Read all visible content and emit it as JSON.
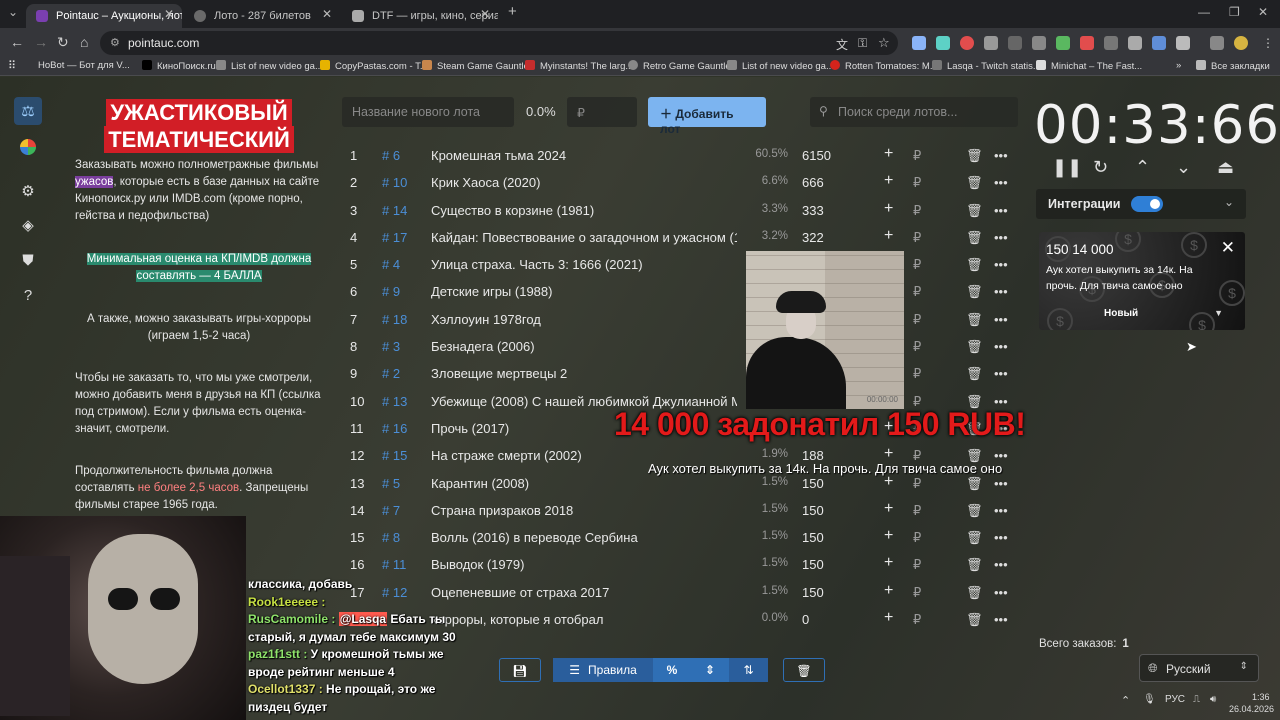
{
  "browser": {
    "tabs": [
      {
        "title": "Pointauc – Аукционы, лотереи",
        "active": true
      },
      {
        "title": "Лото - 287 билетов",
        "active": false
      },
      {
        "title": "DTF — игры, кино, сериалы, р",
        "active": false
      }
    ],
    "url": "pointauc.com",
    "bookmarks": [
      "HoBot — Бот для V...",
      "КиноПоиск.ru",
      "List of new video ga...",
      "CopyPastas.com - T...",
      "Steam Game Gauntlet",
      "Myinstants! The larg...",
      "Retro Game Gauntlet",
      "List of new video ga...",
      "Rotten Tomatoes: M...",
      "Lasqa - Twitch statis...",
      "Minichat – The Fast..."
    ],
    "all_bookmarks": "Все закладки"
  },
  "rules": {
    "title_line1": "УЖАСТИКОВЫЙ",
    "title_line2": "ТЕМАТИЧЕСКИЙ",
    "p1_a": "Заказывать можно полнометражные фильмы ",
    "p1_hl": "ужасов",
    "p1_b": ", которые есть в базе данных на сайте Кинопоиск.ру или IMDB.com (кроме порно, гейства и педофильства)",
    "p2": "Минимальная оценка на КП/IMDB должна составлять — 4 БАЛЛА",
    "p3": "А также, можно заказывать игры-хорроры (играем 1,5-2 часа)",
    "p4": "Чтобы не заказать то, что мы уже смотрели, можно добавить меня в друзья на КП (ссылка под стримом). Если у фильма есть оценка- значит, смотрели.",
    "p5_a": "Продолжительность фильма должна составлять ",
    "p5_red": "не более 2,5 часов",
    "p5_b": ". Запрещены фильмы старее 1965 года."
  },
  "toolbar": {
    "lot_placeholder": "Название нового лота",
    "percent": "0.0%",
    "currency_placeholder": "₽",
    "add_button": "Добавить лот",
    "search_placeholder": "Поиск среди лотов..."
  },
  "lots": [
    {
      "n": "1",
      "id": "# 6",
      "name": "Кромешная тьма 2024",
      "pct": "60.5%",
      "amount": "6150"
    },
    {
      "n": "2",
      "id": "# 10",
      "name": "Крик Хаоса (2020)",
      "pct": "6.6%",
      "amount": "666"
    },
    {
      "n": "3",
      "id": "# 14",
      "name": "Существо в корзине (1981)",
      "pct": "3.3%",
      "amount": "333"
    },
    {
      "n": "4",
      "id": "# 17",
      "name": "Кайдан: Повествование о загадочном и ужасном (19",
      "pct": "3.2%",
      "amount": "322"
    },
    {
      "n": "5",
      "id": "# 4",
      "name": "Улица страха. Часть 3: 1666 (2021)",
      "pct": "",
      "amount": ""
    },
    {
      "n": "6",
      "id": "# 9",
      "name": "Детские игры (1988)",
      "pct": "",
      "amount": ""
    },
    {
      "n": "7",
      "id": "# 18",
      "name": "Хэллоуин 1978год",
      "pct": "",
      "amount": ""
    },
    {
      "n": "8",
      "id": "# 3",
      "name": "Безнадега (2006)",
      "pct": "",
      "amount": ""
    },
    {
      "n": "9",
      "id": "# 2",
      "name": "Зловещие мертвецы 2",
      "pct": "",
      "amount": ""
    },
    {
      "n": "10",
      "id": "# 13",
      "name": "Убежище (2008) С нашей любимкой Джулианной М",
      "pct": "",
      "amount": ""
    },
    {
      "n": "11",
      "id": "# 16",
      "name": "Прочь (2017)",
      "pct": "",
      "amount": ""
    },
    {
      "n": "12",
      "id": "# 15",
      "name": "На страже смерти (2002)",
      "pct": "1.9%",
      "amount": "188"
    },
    {
      "n": "13",
      "id": "# 5",
      "name": "Карантин (2008)",
      "pct": "1.5%",
      "amount": "150"
    },
    {
      "n": "14",
      "id": "# 7",
      "name": "Страна призраков 2018",
      "pct": "1.5%",
      "amount": "150"
    },
    {
      "n": "15",
      "id": "# 8",
      "name": "Волль (2016) в переводе Сербина",
      "pct": "1.5%",
      "amount": "150"
    },
    {
      "n": "16",
      "id": "# 11",
      "name": "Выводок (1979)",
      "pct": "1.5%",
      "amount": "150"
    },
    {
      "n": "17",
      "id": "# 12",
      "name": "Оцепеневшие от страха 2017",
      "pct": "1.5%",
      "amount": "150"
    },
    {
      "n": "",
      "id": "",
      "name": "хорроры, которые я отобрал",
      "pct": "0.0%",
      "amount": "0"
    }
  ],
  "bottom": {
    "rules_label": "Правила"
  },
  "timer": {
    "value": "00:33:66"
  },
  "integrations": {
    "label": "Интеграции",
    "enabled": true
  },
  "donation": {
    "amount": "150 14 000",
    "message": "Аук хотел выкупить за 14к. На прочь. Для твича самое оно",
    "status": "Новый"
  },
  "total": {
    "label": "Всего заказов:",
    "value": "1"
  },
  "language": "Русский",
  "overlay": {
    "alert": "14 000 задонатил 150 RUB!",
    "alert_message": "Аук хотел выкупить за 14к. На прочь. Для твича самое оно",
    "video_timecode": "00:00:00"
  },
  "chat": [
    {
      "user": "",
      "text": "классика, добавь"
    },
    {
      "user": "Rook1eeeee :",
      "text": ""
    },
    {
      "user": "RusCamomile :",
      "mention": "@Lasqa",
      "text": " Ебать ты старый, я думал тебе максимум 30"
    },
    {
      "user": "paz1f1stt :",
      "text": " У кромешной тьмы же вроде рейтинг меньше 4"
    },
    {
      "user": "Ocellot1337 :",
      "text": " Не прощай, это же пиздец будет"
    }
  ],
  "taskbar": {
    "lang": "РУС",
    "time": "1:36",
    "date": "26.04.2026"
  }
}
